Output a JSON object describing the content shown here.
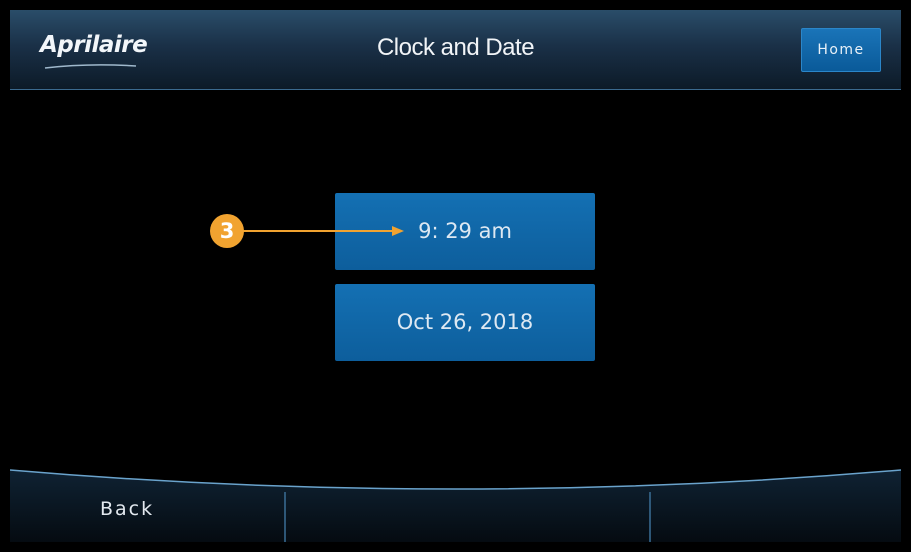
{
  "header": {
    "brand": "Aprilaire",
    "title": "Clock and Date",
    "home_label": "Home"
  },
  "main": {
    "time_label": "9: 29 am",
    "date_label": "Oct 26, 2018",
    "callout_number": "3"
  },
  "footer": {
    "back_label": "Back"
  },
  "colors": {
    "button_blue": "#1470b3",
    "callout_orange": "#f1a330",
    "header_navy": "#1a3047"
  }
}
